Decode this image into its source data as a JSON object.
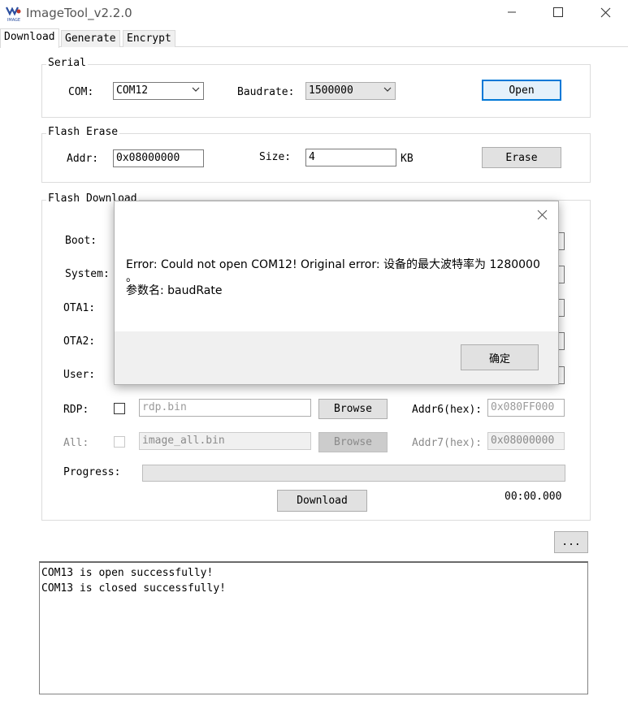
{
  "window": {
    "title": "ImageTool_v2.2.0",
    "logo_text": "IMAGE",
    "controls": [
      "minimize",
      "maximize",
      "close"
    ]
  },
  "tabs": [
    {
      "label": "Download",
      "active": true
    },
    {
      "label": "Generate",
      "active": false
    },
    {
      "label": "Encrypt",
      "active": false
    }
  ],
  "serial": {
    "group_title": "Serial",
    "com_label": "COM:",
    "com_value": "COM12",
    "baud_label": "Baudrate:",
    "baud_value": "1500000",
    "open_label": "Open"
  },
  "flash_erase": {
    "group_title": "Flash Erase",
    "addr_label": "Addr:",
    "addr_value": "0x08000000",
    "size_label": "Size:",
    "size_value": "4",
    "size_unit": "KB",
    "erase_label": "Erase"
  },
  "flash_download": {
    "group_title": "Flash Download",
    "rows": [
      {
        "label": "Boot:"
      },
      {
        "label": "System:"
      },
      {
        "label": "OTA1:"
      },
      {
        "label": "OTA2:"
      },
      {
        "label": "User:"
      }
    ],
    "rdp": {
      "label": "RDP:",
      "file_placeholder": "rdp.bin",
      "browse": "Browse",
      "addr_label": "Addr6(hex):",
      "addr_placeholder": "0x080FF000"
    },
    "all": {
      "label": "All:",
      "file_value": "image_all.bin",
      "browse": "Browse",
      "addr_label": "Addr7(hex):",
      "addr_value": "0x08000000"
    },
    "progress_label": "Progress:",
    "progress_fraction": 0,
    "download_label": "Download",
    "timer": "00:00.000"
  },
  "more_button": "...",
  "log_lines": [
    "COM13 is open successfully!",
    "COM13 is closed successfully!"
  ],
  "dialog": {
    "message_line1": "Error: Could not open COM12! Original error: 设备的最大波特率为 1280000",
    "message_line2": "。",
    "message_line3": "参数名: baudRate",
    "ok_label": "确定"
  },
  "colors": {
    "accent": "#0078d7",
    "button_bg": "#e1e1e1",
    "dialog_footer": "#f0f0f0",
    "group_border": "#dcdcdc"
  }
}
